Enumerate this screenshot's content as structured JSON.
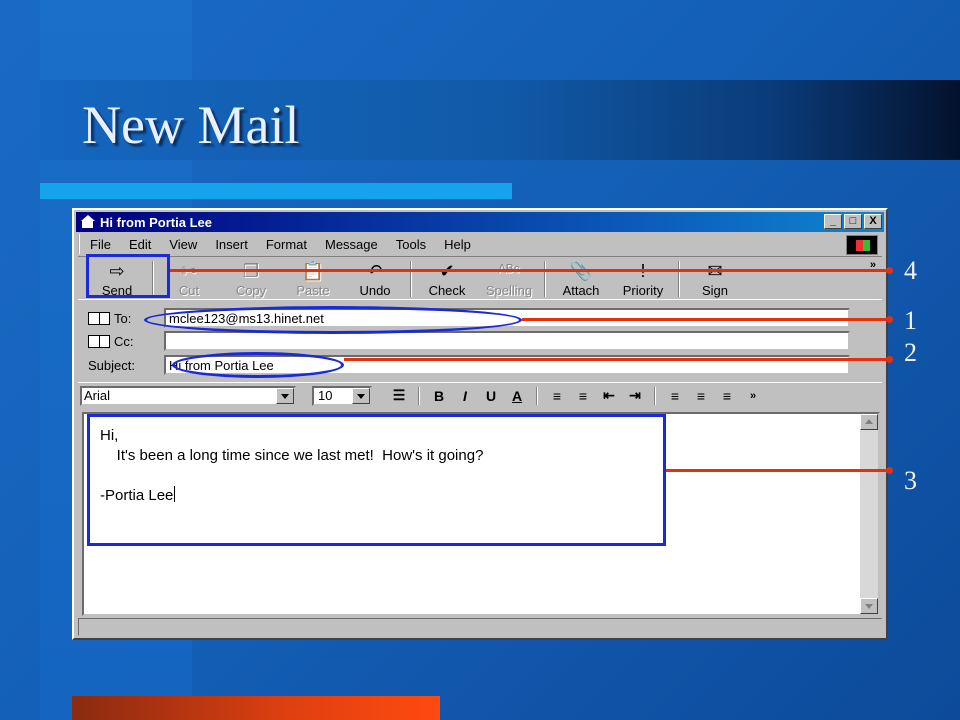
{
  "slide": {
    "title": "New Mail"
  },
  "window": {
    "title": "Hi from Portia Lee",
    "title_buttons": [
      "_",
      "□",
      "X"
    ]
  },
  "menu": [
    "File",
    "Edit",
    "View",
    "Insert",
    "Format",
    "Message",
    "Tools",
    "Help"
  ],
  "toolbar": {
    "buttons": [
      {
        "label": "Send",
        "icon": "send-icon",
        "glyph": "⇨",
        "enabled": true
      },
      {
        "label": "Cut",
        "icon": "scissors-icon",
        "glyph": "✂",
        "enabled": false
      },
      {
        "label": "Copy",
        "icon": "copy-icon",
        "glyph": "❐",
        "enabled": false
      },
      {
        "label": "Paste",
        "icon": "paste-icon",
        "glyph": "📋",
        "enabled": false
      },
      {
        "label": "Undo",
        "icon": "undo-icon",
        "glyph": "↶",
        "enabled": true
      },
      {
        "label": "Check",
        "icon": "check-names-icon",
        "glyph": "✔",
        "enabled": true
      },
      {
        "label": "Spelling",
        "icon": "spelling-icon",
        "glyph": "ᴬᴮᶜ",
        "enabled": false
      },
      {
        "label": "Attach",
        "icon": "paperclip-icon",
        "glyph": "📎",
        "enabled": true
      },
      {
        "label": "Priority",
        "icon": "priority-icon",
        "glyph": "!",
        "enabled": true
      },
      {
        "label": "Sign",
        "icon": "sign-icon",
        "glyph": "✉",
        "enabled": true
      }
    ],
    "more": "»"
  },
  "headers": {
    "to_label": "To:",
    "to_value": "mclee123@ms13.hinet.net",
    "cc_label": "Cc:",
    "cc_value": "",
    "subject_label": "Subject:",
    "subject_value": "Hi from Portia Lee"
  },
  "format_bar": {
    "font": "Arial",
    "size": "10",
    "bold": "B",
    "italic": "I",
    "underline": "U",
    "font_color": "A",
    "more": "»"
  },
  "message_body": {
    "line1": "Hi,",
    "line2": "    It's been a long time since we last met!  How's it going?",
    "line3": "-Portia Lee"
  },
  "callouts": [
    "4",
    "1",
    "2",
    "3"
  ],
  "colors": {
    "highlight": "#1a2ad8",
    "pointer": "#e53010",
    "title_text": "#e8f0ff"
  }
}
